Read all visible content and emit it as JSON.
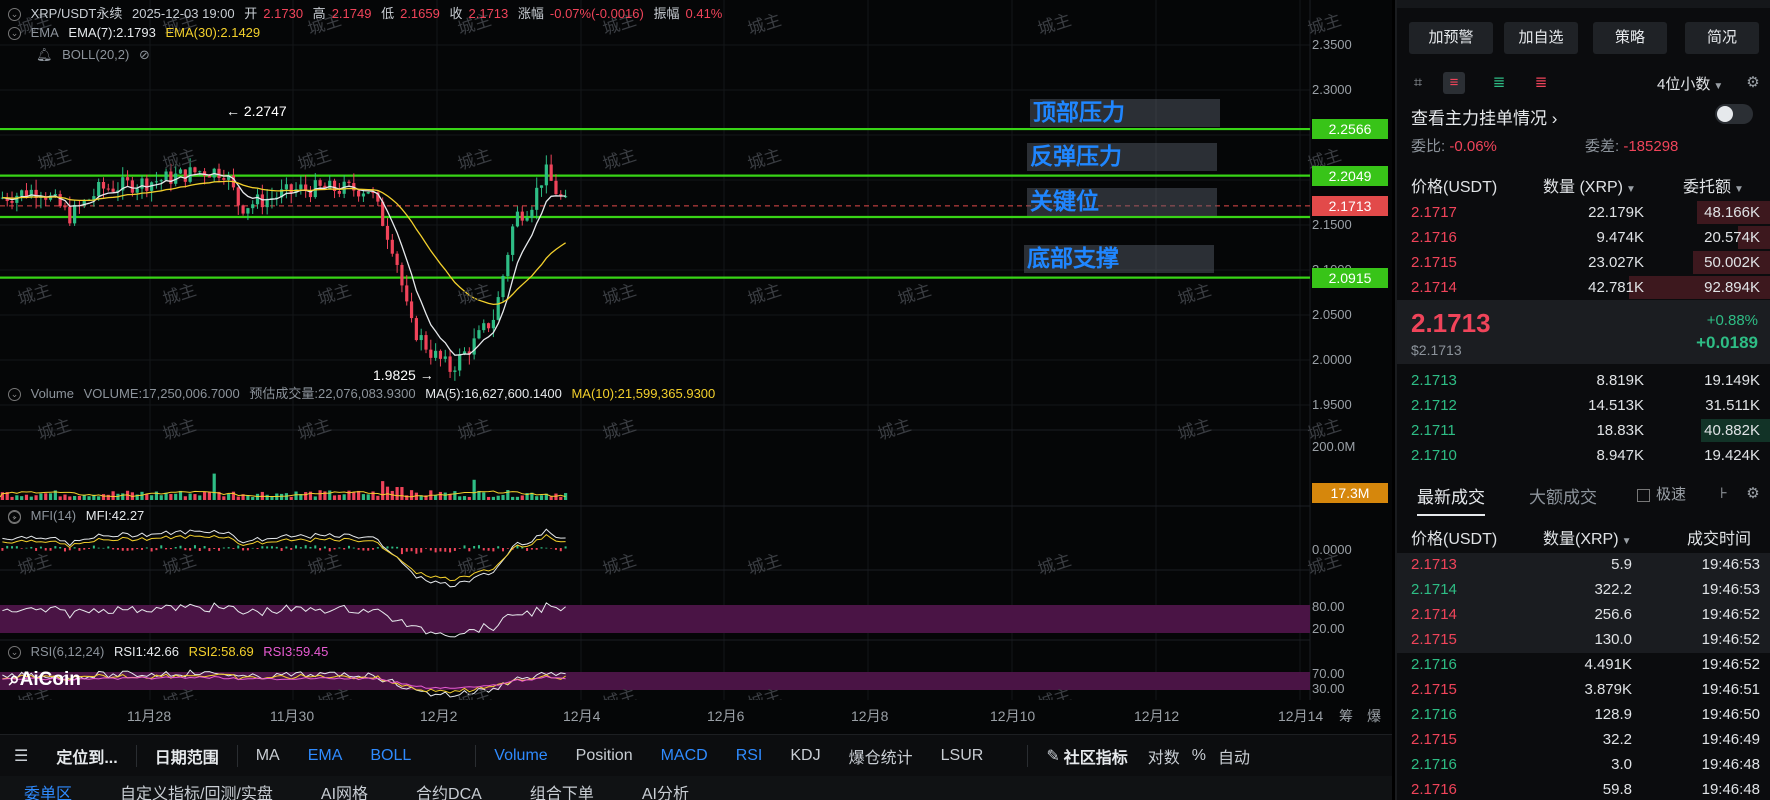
{
  "header": {
    "symbol": "XRP/USDT永续",
    "datetime": "2025-12-03 19:00",
    "open_label": "开",
    "open": "2.1730",
    "high_label": "高",
    "high": "2.1749",
    "low_label": "低",
    "low": "2.1659",
    "close_label": "收",
    "close": "2.1713",
    "change_label": "涨幅",
    "change": "-0.07%(-0.0016)",
    "amp_label": "振幅",
    "amp": "0.41%"
  },
  "indicators": {
    "ema_name": "EMA",
    "ema7": "EMA(7):2.1793",
    "ema30": "EMA(30):2.1429",
    "boll": "BOLL(20,2)",
    "volume_name": "Volume",
    "volume_value": "VOLUME:17,250,006.7000",
    "volume_pred": "预估成交量:22,076,083.9300",
    "ma5": "MA(5):16,627,600.1400",
    "ma10": "MA(10):21,599,365.9300",
    "mfi_name": "MFI(14)",
    "mfi_value": "MFI:42.27",
    "rsi_name": "RSI(6,12,24)",
    "rsi1": "RSI1:42.66",
    "rsi2": "RSI2:58.69",
    "rsi3": "RSI3:59.45"
  },
  "annotations": {
    "high_marker": "← 2.2747",
    "low_marker": "1.9825 →",
    "zone_top": "顶部压力",
    "zone_rebound": "反弹压力",
    "zone_key": "关键位",
    "zone_bottom": "底部支撑",
    "watermark": "城主",
    "logo": "AiCoin"
  },
  "price_axis": [
    "2.3500",
    "2.3000",
    "2.2500",
    "2.1500",
    "2.1000",
    "2.0500",
    "2.0000",
    "1.9500"
  ],
  "price_tags": {
    "top": "2.2566",
    "rebound": "2.2049",
    "current": "2.1713",
    "bottom": "2.0915"
  },
  "volume_axis": {
    "top": "200.0M",
    "tag": "17.3M"
  },
  "macd_axis": {
    "zero": "0.0000"
  },
  "mfi_axis": {
    "upper": "80.00",
    "lower": "20.00"
  },
  "rsi_axis": {
    "upper": "70.00",
    "lower": "30.00"
  },
  "dates": [
    "11月28",
    "11月30",
    "12月2",
    "12月4",
    "12月6",
    "12月8",
    "12月10",
    "12月12",
    "12月14"
  ],
  "date_extra": [
    "筹",
    "爆"
  ],
  "toolbar": {
    "locate": "定位到...",
    "date_range": "日期范围",
    "items": [
      "MA",
      "EMA",
      "BOLL",
      "Volume",
      "Position",
      "MACD",
      "RSI",
      "KDJ",
      "爆仓统计",
      "LSUR"
    ],
    "community": "社区指标",
    "log": "对数",
    "percent": "%",
    "auto": "自动"
  },
  "bottom_tabs": [
    "委单区",
    "自定义指标/回测/实盘",
    "AI网格",
    "合约DCA",
    "组合下单",
    "AI分析"
  ],
  "right": {
    "buttons": [
      "加预警",
      "加自选",
      "策略",
      "简况"
    ],
    "decimal": "4位小数",
    "main_orders": "查看主力挂单情况",
    "ratio_label": "委比:",
    "ratio": "-0.06%",
    "diff_label": "委差:",
    "diff": "-185298",
    "ob_headers": [
      "价格(USDT)",
      "数量 (XRP)",
      "委托额"
    ],
    "asks": [
      {
        "price": "2.1717",
        "qty": "22.179K",
        "total": "48.166K",
        "depth": 0.2
      },
      {
        "price": "2.1716",
        "qty": "9.474K",
        "total": "20.574K",
        "depth": 0.09
      },
      {
        "price": "2.1715",
        "qty": "23.027K",
        "total": "50.002K",
        "depth": 0.21
      },
      {
        "price": "2.1714",
        "qty": "42.781K",
        "total": "92.894K",
        "depth": 0.38
      }
    ],
    "last_price": "2.1713",
    "last_usd": "$2.1713",
    "last_pct": "+0.88%",
    "last_change": "+0.0189",
    "bids": [
      {
        "price": "2.1713",
        "qty": "8.819K",
        "total": "19.149K",
        "depth": 0.0
      },
      {
        "price": "2.1712",
        "qty": "14.513K",
        "total": "31.511K",
        "depth": 0.0
      },
      {
        "price": "2.1711",
        "qty": "18.83K",
        "total": "40.882K",
        "depth": 0.19
      },
      {
        "price": "2.1710",
        "qty": "8.947K",
        "total": "19.424K",
        "depth": 0.0
      }
    ],
    "trade_tabs": [
      "最新成交",
      "大额成交"
    ],
    "fast_label": "极速",
    "trade_headers": [
      "价格(USDT)",
      "数量(XRP)",
      "成交时间"
    ],
    "trades": [
      {
        "price": "2.1713",
        "qty": "5.9",
        "time": "19:46:53",
        "side": "sell"
      },
      {
        "price": "2.1714",
        "qty": "322.2",
        "time": "19:46:53",
        "side": "buy"
      },
      {
        "price": "2.1714",
        "qty": "256.6",
        "time": "19:46:52",
        "side": "sell"
      },
      {
        "price": "2.1715",
        "qty": "130.0",
        "time": "19:46:52",
        "side": "sell"
      },
      {
        "price": "2.1716",
        "qty": "4.491K",
        "time": "19:46:52",
        "side": "buy"
      },
      {
        "price": "2.1715",
        "qty": "3.879K",
        "time": "19:46:51",
        "side": "sell"
      },
      {
        "price": "2.1716",
        "qty": "128.9",
        "time": "19:46:50",
        "side": "buy"
      },
      {
        "price": "2.1715",
        "qty": "32.2",
        "time": "19:46:49",
        "side": "sell"
      },
      {
        "price": "2.1716",
        "qty": "3.0",
        "time": "19:46:48",
        "side": "buy"
      },
      {
        "price": "2.1716",
        "qty": "59.8",
        "time": "19:46:48",
        "side": "sell"
      }
    ]
  },
  "colors": {
    "up": "#2ebd85",
    "down": "#f0445a",
    "accent": "#2f8bff",
    "level_line": "#38d416",
    "ema7": "#e6e9ec",
    "ema30": "#f3d02c",
    "tag_orange": "#d6870c"
  }
}
